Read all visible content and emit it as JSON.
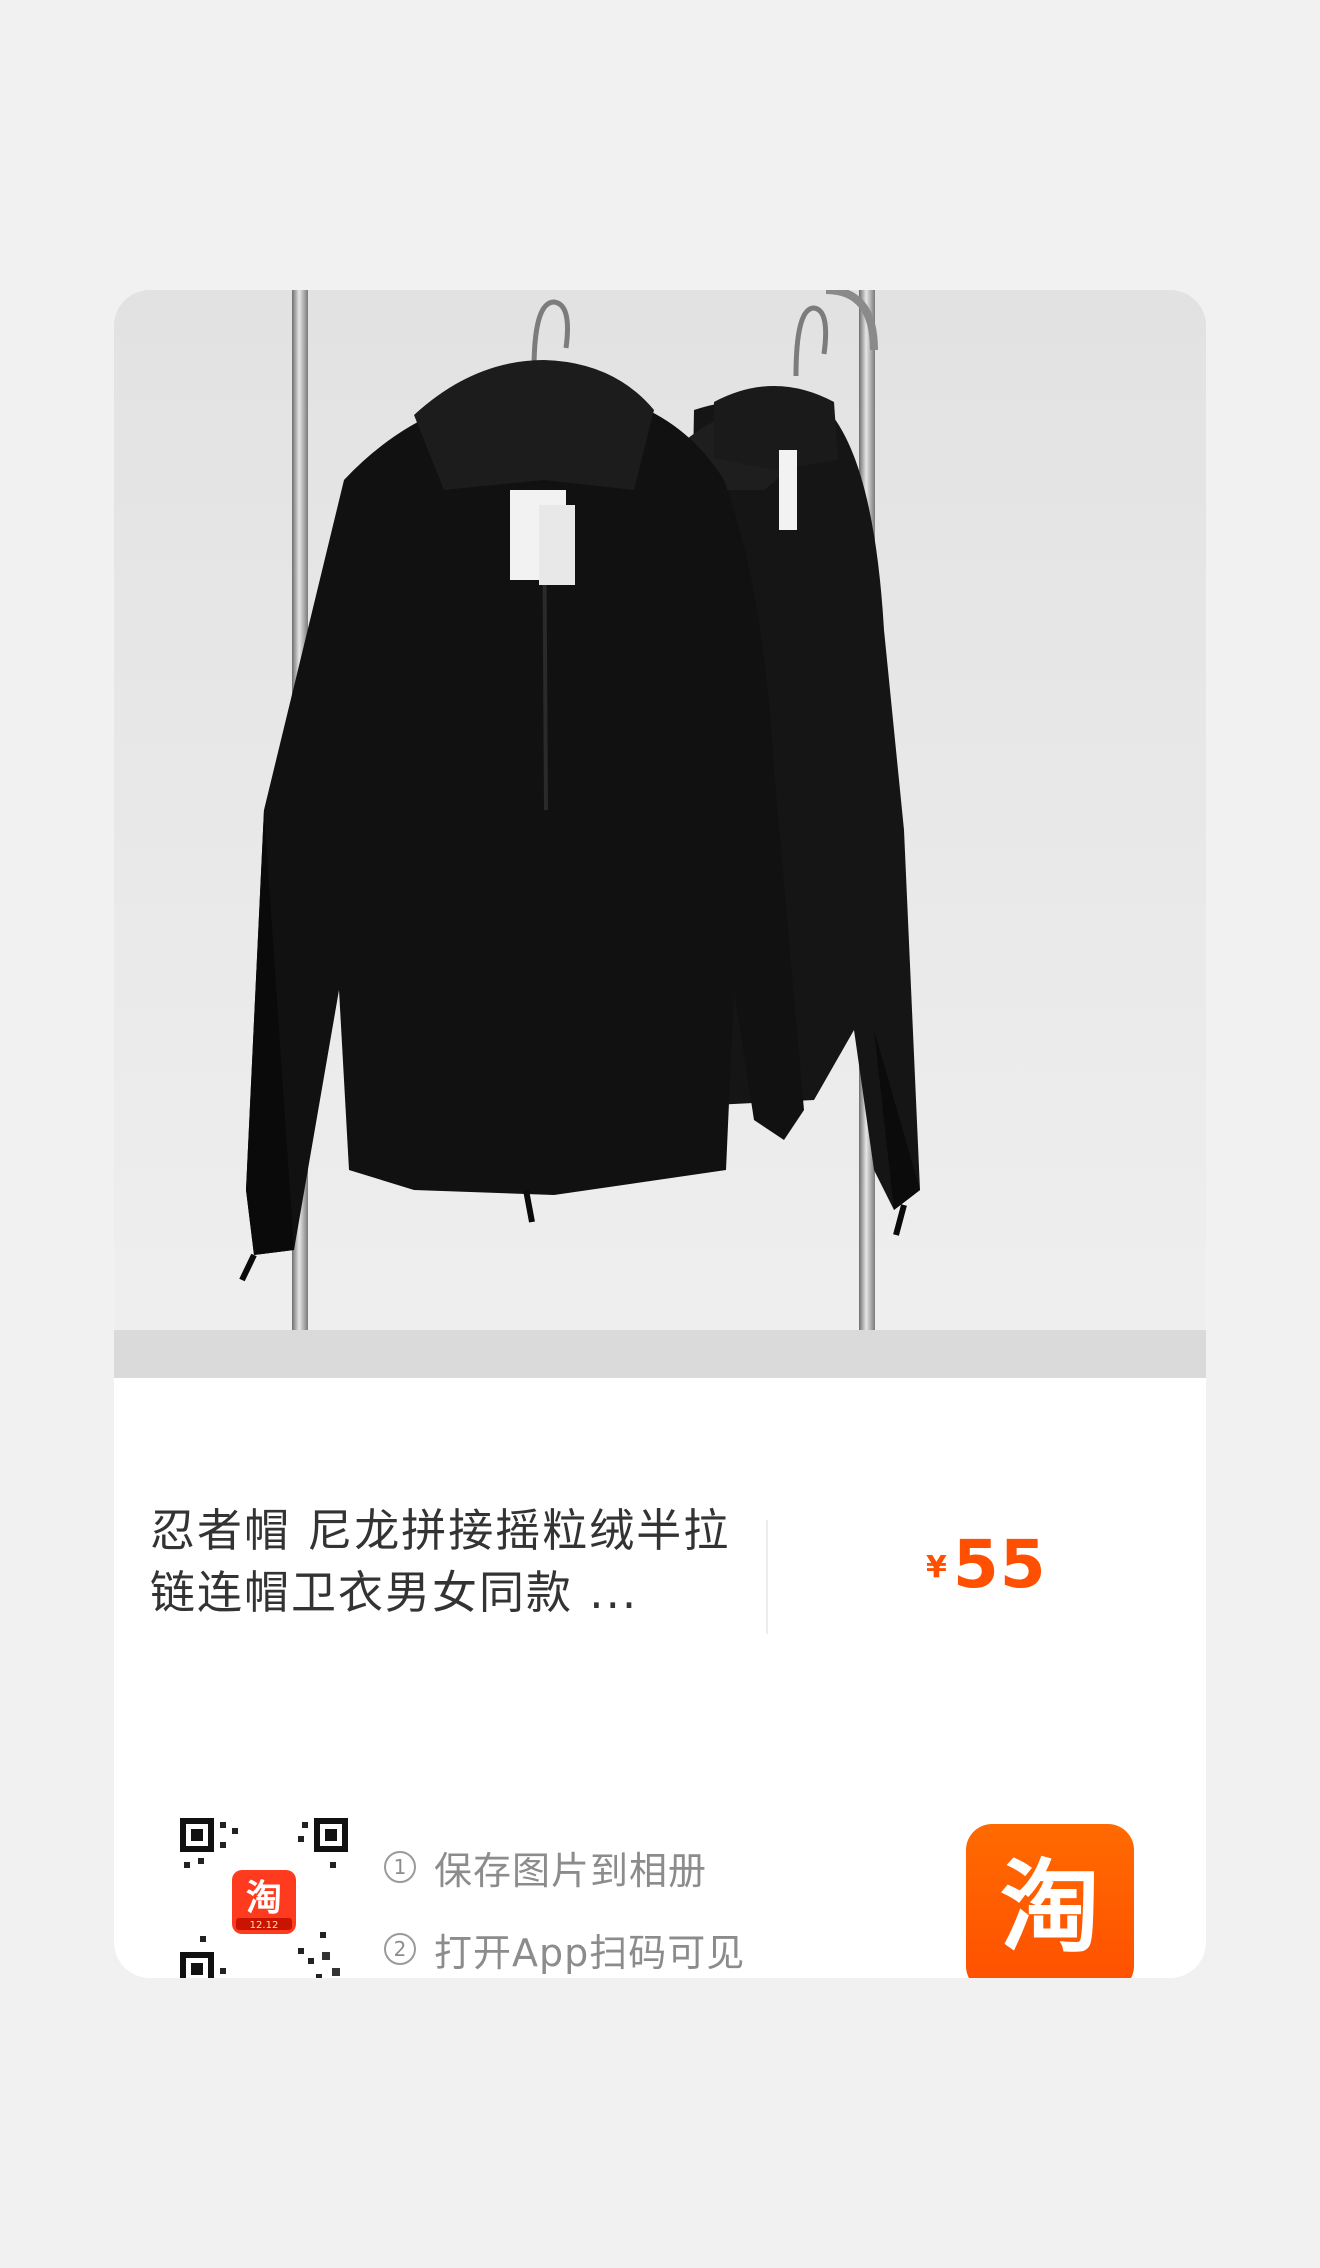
{
  "product": {
    "title": "忍者帽 尼龙拼接摇粒绒半拉链连帽卫衣男女同款 ...",
    "currency_symbol": "¥",
    "price": "55",
    "image_desc": "two black half-zip fleece hoodies on hangers"
  },
  "share": {
    "step1_num": "①",
    "step1_text": "保存图片到相册",
    "step2_num": "②",
    "step2_text": "打开App扫码可见",
    "qr_badge_char": "淘",
    "qr_badge_sub": "12.12"
  },
  "brand": {
    "logo_char": "淘",
    "accent": "#ff5000",
    "logo_bg": "#ff5a00"
  }
}
